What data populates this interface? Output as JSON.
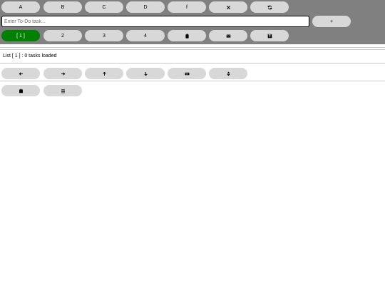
{
  "header": {
    "letter_buttons": [
      "A",
      "B",
      "C",
      "D",
      "f"
    ],
    "close_icon": "close-icon",
    "refresh_icon": "refresh-icon"
  },
  "input": {
    "placeholder": "Enter To-Do task...",
    "value": "",
    "add_label": "+"
  },
  "lists": {
    "tabs": [
      "[ 1 ]",
      "2",
      "3",
      "4"
    ],
    "active_index": 0,
    "active_color": "#008000",
    "action_icons": [
      "clipboard-icon",
      "envelope-icon",
      "save-icon"
    ]
  },
  "status": {
    "text": "List [ 1 ] : 0 tasks loaded"
  },
  "movement": {
    "icons": [
      "arrow-left-icon",
      "arrow-right-icon",
      "arrow-up-icon",
      "arrow-down-icon",
      "keyboard-icon",
      "sort-icon"
    ]
  },
  "bottom": {
    "icons": [
      "calendar-icon",
      "list-icon"
    ]
  },
  "colors": {
    "toolbar_bg": "#808080",
    "button_bg": "#d8d8d8"
  }
}
